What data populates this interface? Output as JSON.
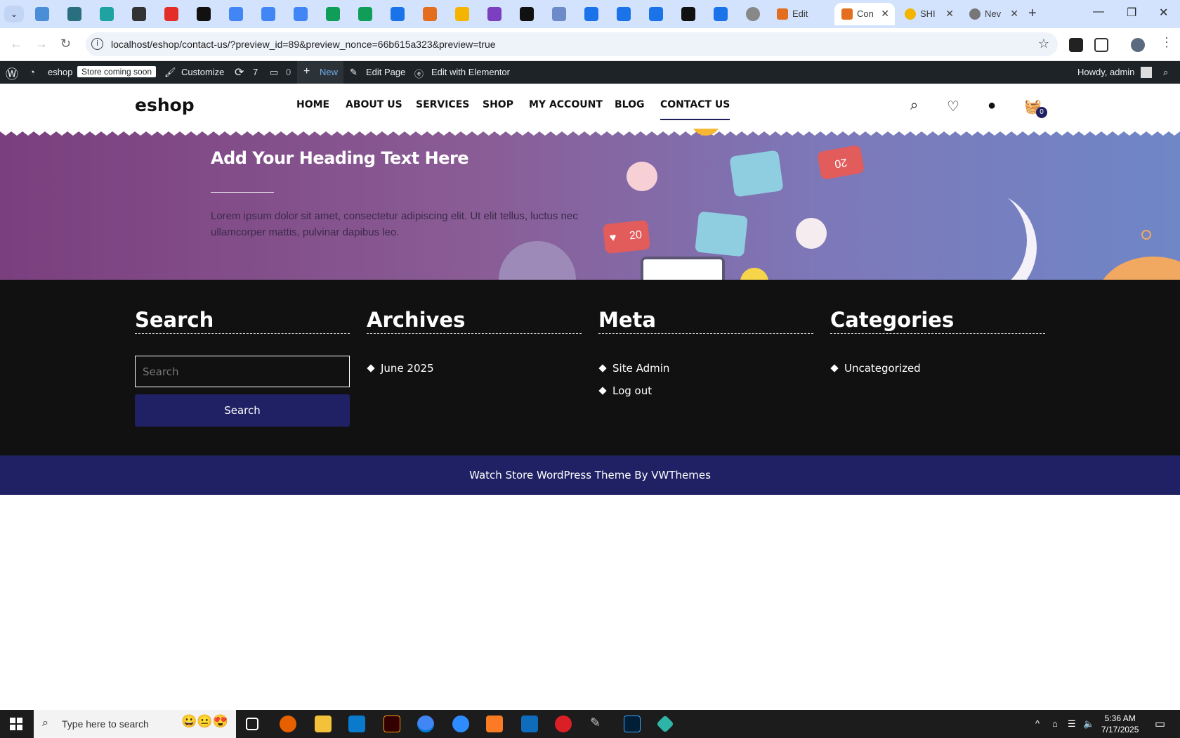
{
  "browser": {
    "tabs": [
      {
        "title": "Edit",
        "favicon_color": "#e36f1e",
        "active": false
      },
      {
        "title": "Con",
        "favicon_color": "#e36f1e",
        "active": true
      },
      {
        "title": "SHI",
        "favicon_color": "#f4b400",
        "active": false
      },
      {
        "title": "Nev",
        "favicon_color": "#777777",
        "active": false
      }
    ],
    "new_tab_symbol": "+",
    "url": "localhost/eshop/contact-us/?preview_id=89&preview_nonce=66b615a323&preview=true"
  },
  "wp_admin_bar": {
    "site_name": "eshop",
    "store_badge": "Store coming soon",
    "customize": "Customize",
    "updates_count": "7",
    "comments_count": "0",
    "new": "New",
    "edit_page": "Edit Page",
    "edit_elementor": "Edit with Elementor",
    "howdy": "Howdy, admin"
  },
  "header": {
    "logo": "eshop",
    "menu": [
      "HOME",
      "ABOUT US",
      "SERVICES",
      "SHOP",
      "MY ACCOUNT",
      "BLOG",
      "CONTACT US"
    ],
    "active_menu": "CONTACT US",
    "cart_count": "0"
  },
  "hero": {
    "heading": "Add Your Heading Text Here",
    "body": "Lorem ipsum dolor sit amet, consectetur adipiscing elit. Ut elit tellus, luctus nec ullamcorper mattis, pulvinar dapibus leo.",
    "like_count_1": "20",
    "like_count_2": "20"
  },
  "footer": {
    "search": {
      "title": "Search",
      "placeholder": "Search",
      "button": "Search"
    },
    "archives": {
      "title": "Archives",
      "items": [
        "June 2025"
      ]
    },
    "meta": {
      "title": "Meta",
      "items": [
        "Site Admin",
        "Log out"
      ]
    },
    "categories": {
      "title": "Categories",
      "items": [
        "Uncategorized"
      ]
    },
    "credit": "Watch Store WordPress Theme By VWThemes"
  },
  "taskbar": {
    "search_placeholder": "Type here to search",
    "time": "5:36 AM",
    "date": "7/17/2025"
  },
  "colors": {
    "accent_navy": "#1f2164",
    "footer_bg": "#111111",
    "hero_purple": "#7a3f7e",
    "hero_blue": "#6f86c7"
  }
}
